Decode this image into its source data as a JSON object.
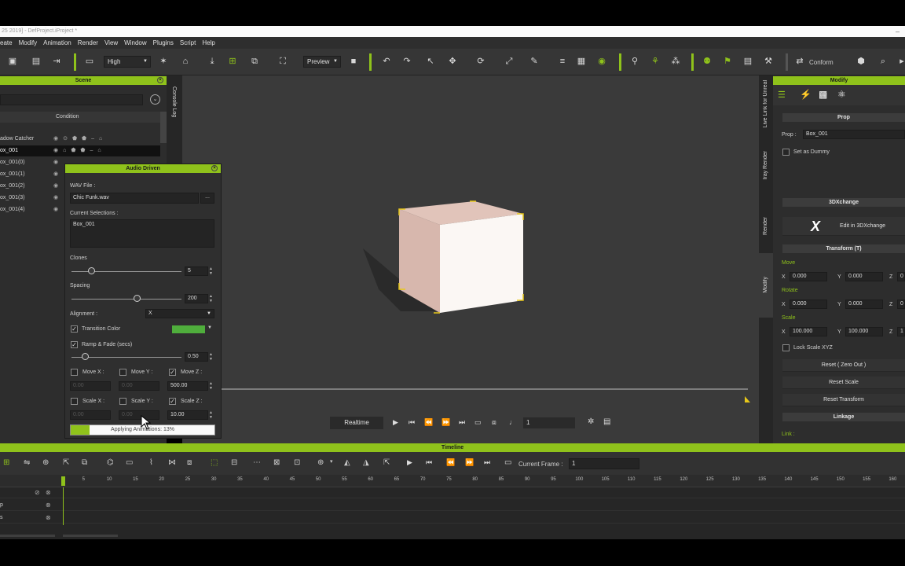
{
  "window": {
    "title": "25 2019] - DefProject.iProject *"
  },
  "menu": [
    "eate",
    "Modify",
    "Animation",
    "Render",
    "View",
    "Window",
    "Plugins",
    "Script",
    "Help"
  ],
  "toolbar": {
    "quality": "High",
    "preview": "Preview",
    "conform": "Conform"
  },
  "scene": {
    "title": "Scene",
    "column_condition": "Condition",
    "items": [
      "adow Catcher",
      "ox_001",
      "ox_001(0)",
      "ox_001(1)",
      "ox_001(2)",
      "ox_001(3)",
      "ox_001(4)"
    ]
  },
  "left_vtabs": {
    "console_log": "Console Log"
  },
  "audio_driven": {
    "title": "Audio Driven",
    "wav_file_label": "WAV File :",
    "wav_file_value": "Chic Funk.wav",
    "browse": "...",
    "current_selections_label": "Current Selections :",
    "current_selections_value": "Box_001",
    "clones_label": "Clones",
    "clones_value": "5",
    "clones_fraction": 0.18,
    "spacing_label": "Spacing",
    "spacing_value": "200",
    "spacing_fraction": 0.59,
    "alignment_label": "Alignment :",
    "alignment_value": "X",
    "transition_color_label": "Transition Color",
    "transition_color": "#4fae3c",
    "ramp_fade_label": "Ramp & Fade (secs)",
    "ramp_fade_value": "0.50",
    "ramp_fade_fraction": 0.12,
    "move_x_label": "Move X :",
    "move_y_label": "Move Y :",
    "move_z_label": "Move Z :",
    "move_x_value": "0.00",
    "move_y_value": "0.00",
    "move_z_value": "500.00",
    "scale_x_label": "Scale X :",
    "scale_y_label": "Scale Y :",
    "scale_z_label": "Scale Z :",
    "scale_x_value": "0.00",
    "scale_y_value": "0.00",
    "scale_z_value": "10.00",
    "progress_text": "Applying Animations: 13%",
    "progress_fraction": 0.13
  },
  "playback": {
    "realtime": "Realtime",
    "frame": "1"
  },
  "right_vtabs": {
    "live_link": "Live Link for Unreal",
    "iray": "Iray Render",
    "render": "Render",
    "modify": "Modify"
  },
  "modify": {
    "title": "Modify",
    "prop_section": "Prop",
    "prop_label": "Prop :",
    "prop_value": "Box_001",
    "set_as_dummy": "Set as Dummy",
    "three_dx_section": "3DXchange",
    "edit_3dx": "Edit in 3DXchange",
    "transform_section": "Transform  (T)",
    "move_label": "Move",
    "rotate_label": "Rotate",
    "scale_label": "Scale",
    "x": "X",
    "y": "Y",
    "z": "Z",
    "move_x": "0.000",
    "move_y": "0.000",
    "rotate_x": "0.000",
    "rotate_y": "0.000",
    "scale_x": "100.000",
    "scale_y": "100.000",
    "move_z_partial": "0",
    "rotate_z_partial": "0",
    "scale_z_partial": "1",
    "lock_scale": "Lock Scale XYZ",
    "reset_zero": "Reset ( Zero Out )",
    "reset_scale": "Reset Scale",
    "reset_transform": "Reset Transform",
    "linkage_section": "Linkage",
    "link_label": "Link :"
  },
  "timeline": {
    "title": "Timeline",
    "current_frame_label": "Current Frame :",
    "current_frame_value": "1",
    "ruler": [
      "5",
      "10",
      "15",
      "20",
      "25",
      "30",
      "35",
      "40",
      "45",
      "50",
      "55",
      "60",
      "65",
      "70",
      "75",
      "80",
      "85",
      "90",
      "95",
      "100",
      "105",
      "110",
      "115",
      "120",
      "125",
      "130",
      "135",
      "140",
      "145",
      "150",
      "155",
      "160"
    ],
    "track_labels": [
      "p",
      "s"
    ]
  },
  "colors": {
    "accent": "#8fc21b"
  }
}
